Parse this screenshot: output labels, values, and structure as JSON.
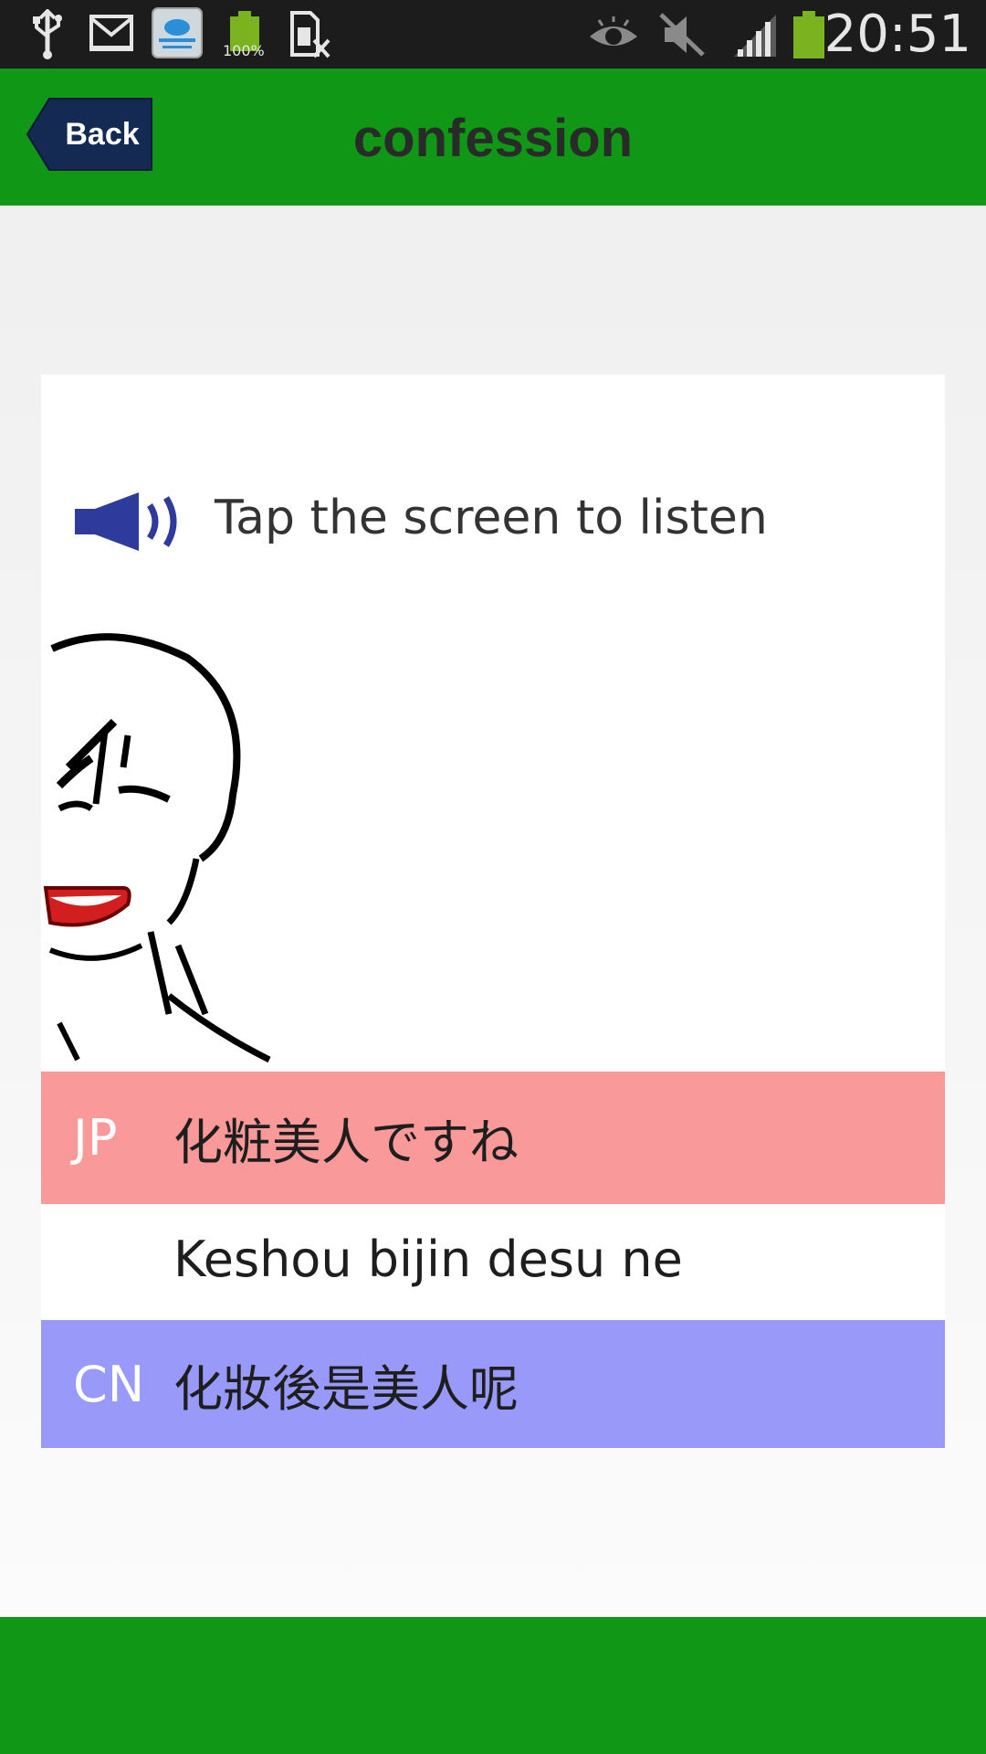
{
  "status_bar": {
    "time": "20:51",
    "icons": [
      "usb-icon",
      "gmail-icon",
      "cloud-testing-app-icon",
      "battery-full-icon",
      "sim-blocked-icon",
      "eye-icon",
      "mute-icon",
      "signal-icon",
      "battery-icon"
    ],
    "battery_percent_label": "100%",
    "cloud_app_label": "Cloud Testing Service NTUT"
  },
  "header": {
    "back_label": "Back",
    "title": "confession",
    "color": "#0f9715"
  },
  "card": {
    "hint": "Tap the screen to listen",
    "speaker_icon": "speaker-icon",
    "rows": {
      "jp": {
        "tag": "JP",
        "text": "化粧美人ですね",
        "color": "#f99999"
      },
      "romaji": {
        "text": "Keshou bijin desu ne"
      },
      "cn": {
        "tag": "CN",
        "text": "化妝後是美人呢",
        "color": "#9999f9"
      }
    }
  },
  "bottom_bar": {
    "color": "#0f9715"
  }
}
